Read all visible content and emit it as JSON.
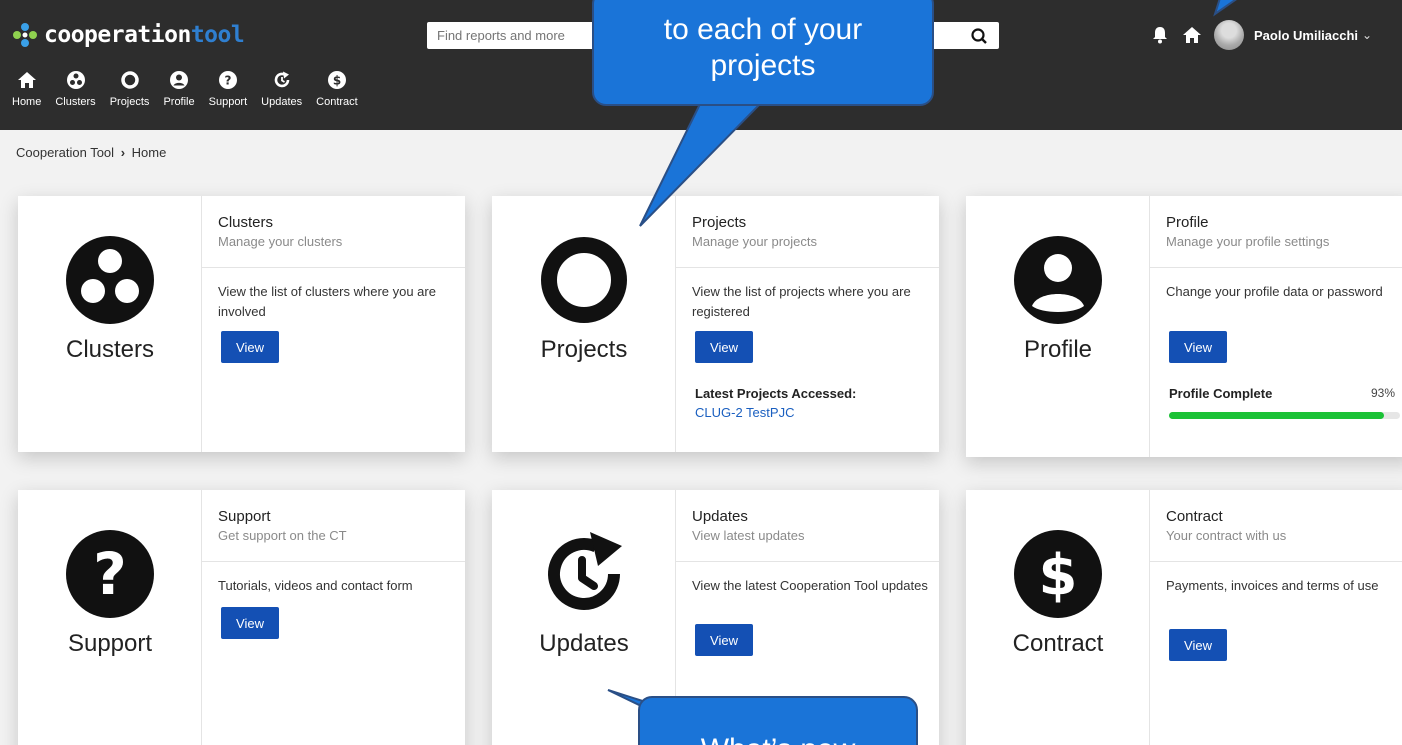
{
  "app": {
    "logo_main": "cooperation",
    "logo_accent": "tool"
  },
  "search": {
    "placeholder": "Find reports and more"
  },
  "user": {
    "name": "Paolo Umiliacchi",
    "chevron": "⌄"
  },
  "nav": {
    "items": [
      {
        "label": "Home",
        "icon": "home-icon"
      },
      {
        "label": "Clusters",
        "icon": "clusters-icon"
      },
      {
        "label": "Projects",
        "icon": "projects-icon"
      },
      {
        "label": "Profile",
        "icon": "profile-icon"
      },
      {
        "label": "Support",
        "icon": "support-icon"
      },
      {
        "label": "Updates",
        "icon": "updates-icon"
      },
      {
        "label": "Contract",
        "icon": "contract-icon"
      }
    ]
  },
  "breadcrumb": {
    "root": "Cooperation Tool",
    "separator": "›",
    "current": "Home"
  },
  "cards": {
    "clusters": {
      "big_label": "Clusters",
      "title": "Clusters",
      "subtitle": "Manage your clusters",
      "description": "View the list of clusters where you are involved",
      "button": "View"
    },
    "projects": {
      "big_label": "Projects",
      "title": "Projects",
      "subtitle": "Manage your projects",
      "description": "View the list of projects where you are registered",
      "button": "View",
      "latest_label": "Latest Projects Accessed:",
      "latest_link": "CLUG-2 TestPJC"
    },
    "profile": {
      "big_label": "Profile",
      "title": "Profile",
      "subtitle": "Manage your profile settings",
      "description": "Change your profile data or password",
      "button": "View",
      "progress_label": "Profile Complete",
      "progress_text": "93%",
      "progress_value": 0.93
    },
    "support": {
      "big_label": "Support",
      "title": "Support",
      "subtitle": "Get support on the CT",
      "description": "Tutorials, videos and contact form",
      "button": "View"
    },
    "updates": {
      "big_label": "Updates",
      "title": "Updates",
      "subtitle": "View latest updates",
      "description": "View the latest Cooperation Tool updates",
      "button": "View"
    },
    "contract": {
      "big_label": "Contract",
      "title": "Contract",
      "subtitle": "Your contract with us",
      "description": "Payments, invoices and terms of use",
      "button": "View"
    }
  },
  "callouts": {
    "top": "to each of your projects",
    "bottom": "What’s new"
  },
  "colors": {
    "topbar": "#2d2d2d",
    "accent": "#1450b4",
    "logo_accent": "#2f7fd0",
    "progress": "#1bc236",
    "callout": "#1a74d8"
  }
}
